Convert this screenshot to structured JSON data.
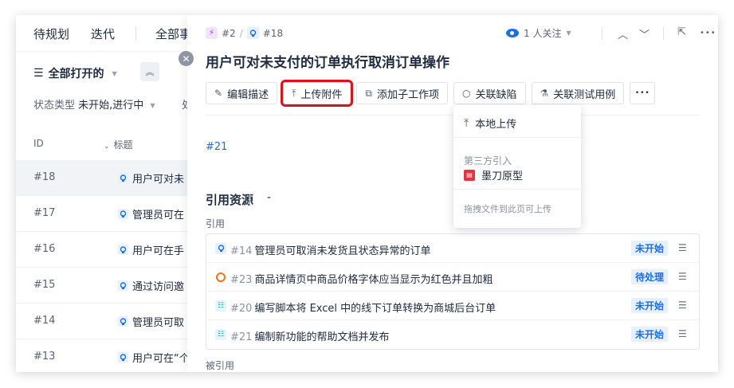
{
  "topnav": {
    "items": [
      "待规划",
      "迭代",
      "全部事"
    ]
  },
  "filter": {
    "title": "全部打开的",
    "status_label": "状态类型",
    "status_value": "未开始,进行中",
    "extra_label": "处"
  },
  "list": {
    "col_id": "ID",
    "col_title": "标题",
    "rows": [
      {
        "id": "#18",
        "title": "用户可对未"
      },
      {
        "id": "#17",
        "title": "管理员可在"
      },
      {
        "id": "#16",
        "title": "用户可在手"
      },
      {
        "id": "#15",
        "title": "通过访问邀"
      },
      {
        "id": "#14",
        "title": "管理员可取"
      },
      {
        "id": "#13",
        "title": "用户可在“个"
      }
    ]
  },
  "drawer": {
    "crumb_parent": "#2",
    "crumb_sep": "/",
    "crumb_current": "#18",
    "watch_label": "1 人关注",
    "title": "用户可对未支付的订单执行取消订单操作",
    "actions": {
      "edit": "编辑描述",
      "upload": "上传附件",
      "add_child": "添加子工作项",
      "link_bug": "关联缺陷",
      "link_test": "关联测试用例",
      "more": "•••"
    },
    "description_link": "#21",
    "refs_title": "引用资源",
    "refs_rest": "-",
    "ref_label": "引用",
    "referenced_by_label": "被引用",
    "refs": [
      {
        "type": "story",
        "num": "#14",
        "title": "管理员可取消未发货且状态异常的订单",
        "status": "未开始",
        "status_kind": "notstart"
      },
      {
        "type": "bug",
        "num": "#23",
        "title": "商品详情页中商品价格字体应当显示为红色并且加粗",
        "status": "待处理",
        "status_kind": "pending"
      },
      {
        "type": "task",
        "num": "#20",
        "title": "编写脚本将 Excel 中的线下订单转换为商城后台订单",
        "status": "未开始",
        "status_kind": "notstart"
      },
      {
        "type": "task",
        "num": "#21",
        "title": "编制新功能的帮助文档并发布",
        "status": "未开始",
        "status_kind": "notstart"
      }
    ]
  },
  "dropdown": {
    "local_upload": "本地上传",
    "group_label": "第三方引入",
    "modao": "墨刀原型",
    "hint": "拖拽文件到此页可上传"
  }
}
